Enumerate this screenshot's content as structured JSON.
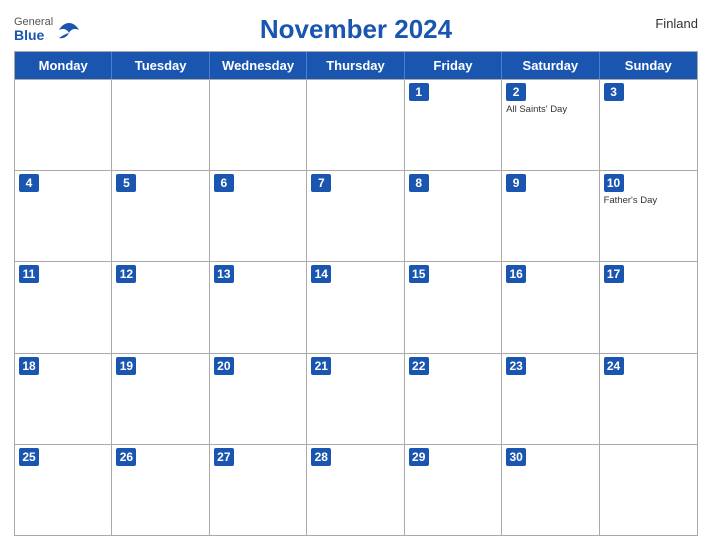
{
  "header": {
    "title": "November 2024",
    "country": "Finland",
    "logo": {
      "general": "General",
      "blue": "Blue"
    }
  },
  "days": [
    "Monday",
    "Tuesday",
    "Wednesday",
    "Thursday",
    "Friday",
    "Saturday",
    "Sunday"
  ],
  "weeks": [
    [
      {
        "date": "",
        "holiday": ""
      },
      {
        "date": "",
        "holiday": ""
      },
      {
        "date": "",
        "holiday": ""
      },
      {
        "date": "",
        "holiday": ""
      },
      {
        "date": "1",
        "holiday": ""
      },
      {
        "date": "2",
        "holiday": "All Saints' Day"
      },
      {
        "date": "3",
        "holiday": ""
      }
    ],
    [
      {
        "date": "4",
        "holiday": ""
      },
      {
        "date": "5",
        "holiday": ""
      },
      {
        "date": "6",
        "holiday": ""
      },
      {
        "date": "7",
        "holiday": ""
      },
      {
        "date": "8",
        "holiday": ""
      },
      {
        "date": "9",
        "holiday": ""
      },
      {
        "date": "10",
        "holiday": "Father's Day"
      }
    ],
    [
      {
        "date": "11",
        "holiday": ""
      },
      {
        "date": "12",
        "holiday": ""
      },
      {
        "date": "13",
        "holiday": ""
      },
      {
        "date": "14",
        "holiday": ""
      },
      {
        "date": "15",
        "holiday": ""
      },
      {
        "date": "16",
        "holiday": ""
      },
      {
        "date": "17",
        "holiday": ""
      }
    ],
    [
      {
        "date": "18",
        "holiday": ""
      },
      {
        "date": "19",
        "holiday": ""
      },
      {
        "date": "20",
        "holiday": ""
      },
      {
        "date": "21",
        "holiday": ""
      },
      {
        "date": "22",
        "holiday": ""
      },
      {
        "date": "23",
        "holiday": ""
      },
      {
        "date": "24",
        "holiday": ""
      }
    ],
    [
      {
        "date": "25",
        "holiday": ""
      },
      {
        "date": "26",
        "holiday": ""
      },
      {
        "date": "27",
        "holiday": ""
      },
      {
        "date": "28",
        "holiday": ""
      },
      {
        "date": "29",
        "holiday": ""
      },
      {
        "date": "30",
        "holiday": ""
      },
      {
        "date": "",
        "holiday": ""
      }
    ]
  ]
}
